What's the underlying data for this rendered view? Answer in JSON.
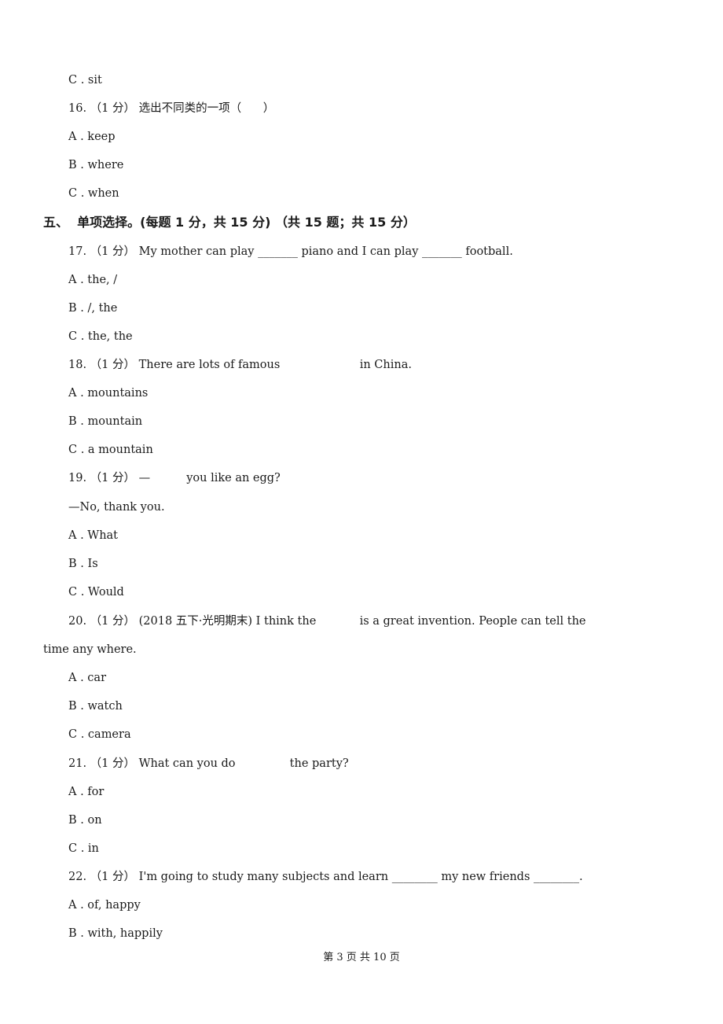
{
  "document": {
    "lines": {
      "q15_c": "C . sit",
      "q16_stem": "16. （1 分） 选出不同类的一项（      ）",
      "q16_a": "A . keep",
      "q16_b": "B . where",
      "q16_c": "C . when",
      "section5": "五、  单项选择。(每题 1 分，共 15 分) （共 15 题；共 15 分）",
      "q17_stem": "17. （1 分） My mother can play _______ piano and I can play _______ football.",
      "q17_a": "A . the, /",
      "q17_b": "B . /, the",
      "q17_c": "C . the, the",
      "q18_stem": "18. （1 分） There are lots of famous                      in China.",
      "q18_a": "A . mountains",
      "q18_b": "B . mountain",
      "q18_c": "C . a mountain",
      "q19_stem": "19. （1 分） —          you like an egg?",
      "q19_reply": "—No, thank you.",
      "q19_a": "A . What",
      "q19_b": "B . Is",
      "q19_c": "C . Would",
      "q20_stem": "20. （1 分） (2018 五下·光明期末) I think the            is a great invention. People can tell the",
      "q20_cont": "time any where.",
      "q20_a": "A . car",
      "q20_b": "B . watch",
      "q20_c": "C . camera",
      "q21_stem": "21. （1 分） What can you do               the party?",
      "q21_a": "A . for",
      "q21_b": "B . on",
      "q21_c": "C . in",
      "q22_stem": "22. （1 分） I'm going to study many subjects and learn ________ my new friends ________.",
      "q22_a": "A . of, happy",
      "q22_b": "B . with, happily"
    },
    "footer": "第 3 页 共 10 页"
  }
}
